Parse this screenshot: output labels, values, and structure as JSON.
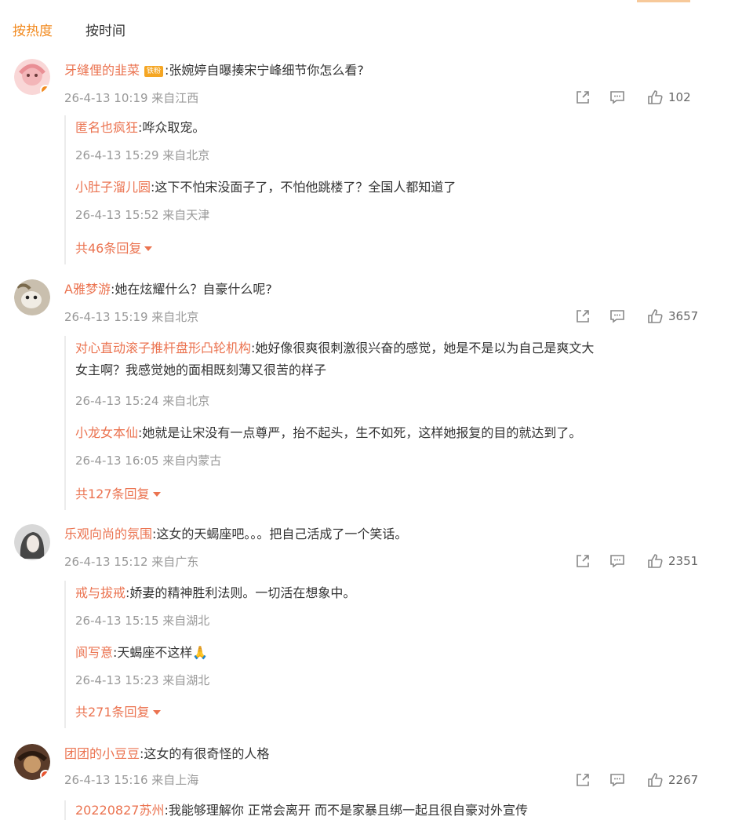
{
  "sort": {
    "hot": "按热度",
    "time": "按时间"
  },
  "comments": [
    {
      "user": "牙缝俚的韭菜",
      "badge": "铁粉",
      "text": ":张婉婷自曝揍宋宁峰细节你怎么看?",
      "time": "26-4-13 10:19 来自江西",
      "likes": "102",
      "replies": [
        {
          "user": "匿名也疯狂",
          "text": ":哗众取宠。",
          "time": "26-4-13 15:29 来自北京"
        },
        {
          "user": "小肚子溜儿圆",
          "text": ":这下不怕宋没面子了，不怕他跳楼了？全国人都知道了",
          "time": "26-4-13 15:52 来自天津"
        }
      ],
      "more": "共46条回复"
    },
    {
      "user": "A雅梦游",
      "text": ":她在炫耀什么？自豪什么呢?",
      "time": "26-4-13 15:19 来自北京",
      "likes": "3657",
      "replies": [
        {
          "user": "对心直动滚子推杆盘形凸轮机构",
          "text": ":她好像很爽很刺激很兴奋的感觉，她是不是以为自己是爽文大",
          "text2": "女主啊？我感觉她的面相既刻薄又很苦的样子",
          "time": "26-4-13 15:24 来自北京"
        },
        {
          "user": "小龙女本仙",
          "text": ":她就是让宋没有一点尊严，抬不起头，生不如死，这样她报复的目的就达到了。",
          "time": "26-4-13 16:05 来自内蒙古"
        }
      ],
      "more": "共127条回复"
    },
    {
      "user": "乐观向尚的氛围",
      "text": ":这女的天蝎座吧。。。把自己活成了一个笑话。",
      "time": "26-4-13 15:12 来自广东",
      "likes": "2351",
      "replies": [
        {
          "user": "戒与拔戒",
          "text": ":娇妻的精神胜利法则。一切活在想象中。",
          "time": "26-4-13 15:15 来自湖北"
        },
        {
          "user": "阆写意",
          "text": ":天蝎座不这样🙏",
          "time": "26-4-13 15:23 来自湖北"
        }
      ],
      "more": "共271条回复"
    },
    {
      "user": "团团的小豆豆",
      "text": ":这女的有很奇怪的人格",
      "time": "26-4-13 15:16 来自上海",
      "likes": "2267",
      "replies": [
        {
          "user": "20220827苏州",
          "text": ":我能够理解你 正常会离开 而不是家暴且绑一起且很自豪对外宣传"
        }
      ]
    }
  ],
  "icons": {
    "share": "share-icon",
    "comment": "comment-icon",
    "like": "like-icon"
  },
  "colors": {
    "accent": "#f28b21",
    "username": "#eb7350",
    "meta": "#999999"
  }
}
